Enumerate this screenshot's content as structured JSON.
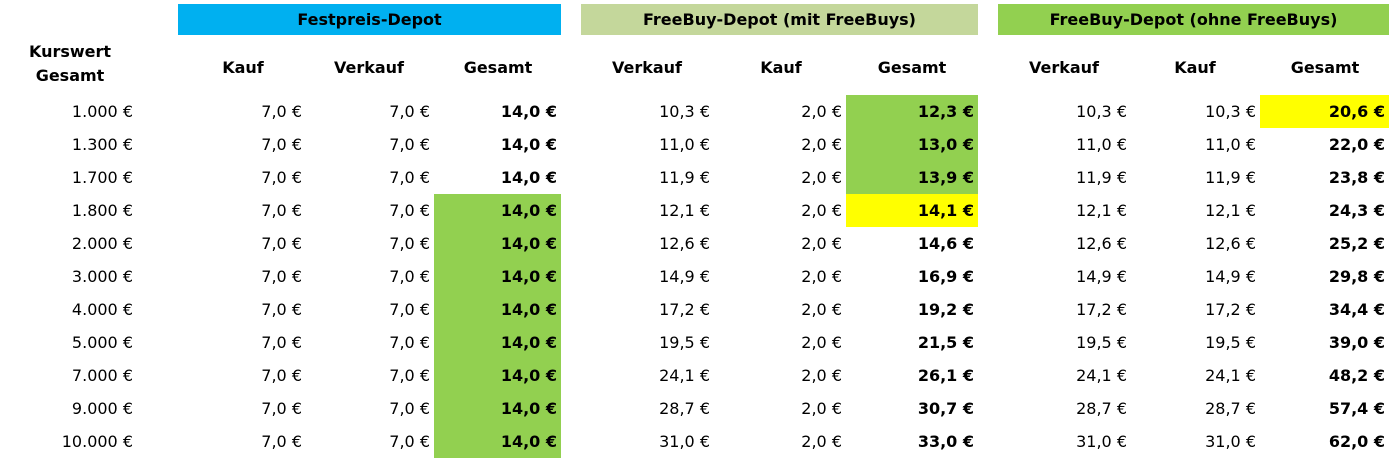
{
  "groups": [
    {
      "title": "Festpreis-Depot",
      "color": "#00b0f0"
    },
    {
      "title": "FreeBuy-Depot (mit FreeBuys)",
      "color": "#c4d79b"
    },
    {
      "title": "FreeBuy-Depot (ohne FreeBuys)",
      "color": "#92d050"
    }
  ],
  "row_header": [
    "Kurswert",
    "Gesamt"
  ],
  "columns": [
    {
      "label": "Kauf",
      "group": 0
    },
    {
      "label": "Verkauf",
      "group": 0
    },
    {
      "label": "Gesamt",
      "group": 0
    },
    {
      "label": "Verkauf",
      "group": 1
    },
    {
      "label": "Kauf",
      "group": 1
    },
    {
      "label": "Gesamt",
      "group": 1
    },
    {
      "label": "Verkauf",
      "group": 2
    },
    {
      "label": "Kauf",
      "group": 2
    },
    {
      "label": "Gesamt",
      "group": 2
    }
  ],
  "highlight_colors": {
    "green": "#92d050",
    "yellow": "#ffff00"
  },
  "rows": [
    {
      "kurswert": "1.000 €",
      "cells": [
        "7,0 €",
        "7,0 €",
        "14,0 €",
        "10,3 €",
        "2,0 €",
        "12,3 €",
        "10,3 €",
        "10,3 €",
        "20,6 €"
      ],
      "highlight": {
        "5": "green",
        "8": "yellow"
      }
    },
    {
      "kurswert": "1.300 €",
      "cells": [
        "7,0 €",
        "7,0 €",
        "14,0 €",
        "11,0 €",
        "2,0 €",
        "13,0 €",
        "11,0 €",
        "11,0 €",
        "22,0 €"
      ],
      "highlight": {
        "5": "green"
      }
    },
    {
      "kurswert": "1.700 €",
      "cells": [
        "7,0 €",
        "7,0 €",
        "14,0 €",
        "11,9 €",
        "2,0 €",
        "13,9 €",
        "11,9 €",
        "11,9 €",
        "23,8 €"
      ],
      "highlight": {
        "5": "green"
      }
    },
    {
      "kurswert": "1.800 €",
      "cells": [
        "7,0 €",
        "7,0 €",
        "14,0 €",
        "12,1 €",
        "2,0 €",
        "14,1 €",
        "12,1 €",
        "12,1 €",
        "24,3 €"
      ],
      "highlight": {
        "2": "green",
        "5": "yellow"
      }
    },
    {
      "kurswert": "2.000 €",
      "cells": [
        "7,0 €",
        "7,0 €",
        "14,0 €",
        "12,6 €",
        "2,0 €",
        "14,6 €",
        "12,6 €",
        "12,6 €",
        "25,2 €"
      ],
      "highlight": {
        "2": "green"
      }
    },
    {
      "kurswert": "3.000 €",
      "cells": [
        "7,0 €",
        "7,0 €",
        "14,0 €",
        "14,9 €",
        "2,0 €",
        "16,9 €",
        "14,9 €",
        "14,9 €",
        "29,8 €"
      ],
      "highlight": {
        "2": "green"
      }
    },
    {
      "kurswert": "4.000 €",
      "cells": [
        "7,0 €",
        "7,0 €",
        "14,0 €",
        "17,2 €",
        "2,0 €",
        "19,2 €",
        "17,2 €",
        "17,2 €",
        "34,4 €"
      ],
      "highlight": {
        "2": "green"
      }
    },
    {
      "kurswert": "5.000 €",
      "cells": [
        "7,0 €",
        "7,0 €",
        "14,0 €",
        "19,5 €",
        "2,0 €",
        "21,5 €",
        "19,5 €",
        "19,5 €",
        "39,0 €"
      ],
      "highlight": {
        "2": "green"
      }
    },
    {
      "kurswert": "7.000 €",
      "cells": [
        "7,0 €",
        "7,0 €",
        "14,0 €",
        "24,1 €",
        "2,0 €",
        "26,1 €",
        "24,1 €",
        "24,1 €",
        "48,2 €"
      ],
      "highlight": {
        "2": "green"
      }
    },
    {
      "kurswert": "9.000 €",
      "cells": [
        "7,0 €",
        "7,0 €",
        "14,0 €",
        "28,7 €",
        "2,0 €",
        "30,7 €",
        "28,7 €",
        "28,7 €",
        "57,4 €"
      ],
      "highlight": {
        "2": "green"
      }
    },
    {
      "kurswert": "10.000 €",
      "cells": [
        "7,0 €",
        "7,0 €",
        "14,0 €",
        "31,0 €",
        "2,0 €",
        "33,0 €",
        "31,0 €",
        "31,0 €",
        "62,0 €"
      ],
      "highlight": {
        "2": "green"
      }
    }
  ]
}
